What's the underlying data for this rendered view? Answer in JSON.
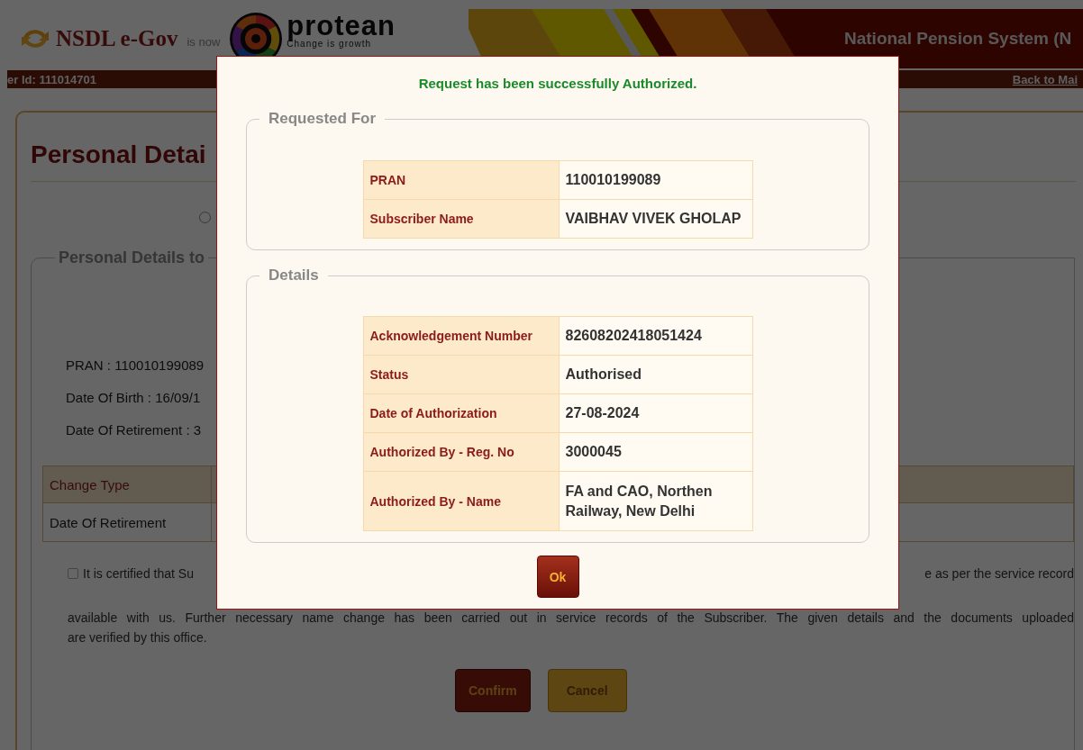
{
  "header": {
    "brand": "NSDL e-Gov",
    "is_now": "is now",
    "protean": "protean",
    "tagline": "Change is growth",
    "system_title": "National Pension System (N"
  },
  "user_bar": {
    "user_id": "er Id: 111014701",
    "back_link": "Back to Mai"
  },
  "page": {
    "title": "Personal Detai",
    "radio": {
      "selected": false
    },
    "legend": "Personal Details to",
    "fields": [
      "PRAN : 110010199089",
      "Date Of Birth : 16/09/1",
      "Date Of Retirement : 3"
    ],
    "table": {
      "columns": [
        "Change Type"
      ],
      "rows": [
        [
          "Date Of Retirement"
        ]
      ]
    },
    "certificate": {
      "checked": false,
      "line_1_start": "It is certified that Su",
      "line_1_end": "e as per the service record",
      "line_2": "available with us. Further necessary name change has been carried out in service records of the Subscriber. The given details and the documents uploaded",
      "line_3": "are verified by this office."
    },
    "buttons": [
      {
        "label": "Confirm",
        "kind": "confirm"
      },
      {
        "label": "Cancel",
        "kind": "cancel"
      }
    ]
  },
  "dialog": {
    "message": "Request has been successfully Authorized.",
    "sections": [
      {
        "legend": "Requested For",
        "rows": [
          {
            "label": "PRAN",
            "value": "110010199089"
          },
          {
            "label": "Subscriber Name",
            "value": "VAIBHAV VIVEK GHOLAP"
          }
        ]
      },
      {
        "legend": "Details",
        "rows": [
          {
            "label": "Acknowledgement Number",
            "value": "82608202418051424"
          },
          {
            "label": "Status",
            "value": "Authorised"
          },
          {
            "label": "Date of Authorization",
            "value": "27-08-2024"
          },
          {
            "label": "Authorized By - Reg. No",
            "value": "3000045"
          },
          {
            "label": "Authorized By - Name",
            "value": "FA and CAO, Northen Railway, New Delhi"
          }
        ]
      }
    ],
    "ok_button": "Ok"
  }
}
